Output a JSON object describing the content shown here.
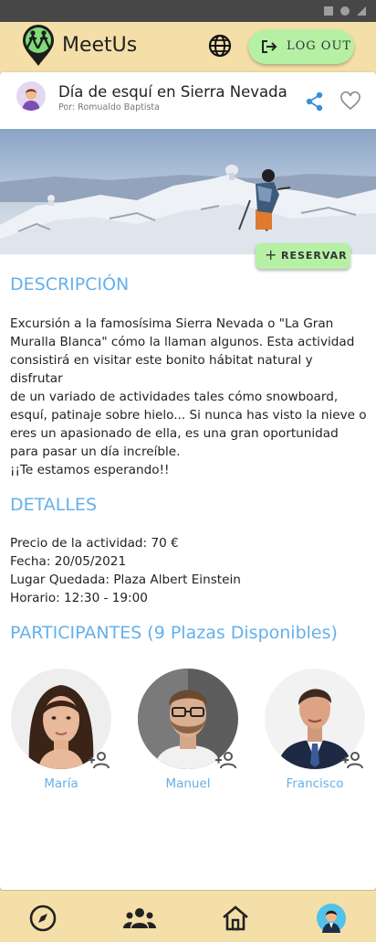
{
  "app": {
    "name": "MeetUs",
    "logout_label": "LOG OUT"
  },
  "event": {
    "title": "Día de esquí en Sierra Nevada",
    "author": "Por: Romualdo Baptista",
    "reserve_label": "RESERVAR"
  },
  "description": {
    "heading": "DESCRIPCIÓN",
    "lines": [
      "Excursión a la famosísima Sierra Nevada o \"La Gran",
      "Muralla Blanca\" cómo la llaman algunos. Esta actividad",
      "consistirá en visitar este bonito hábitat natural y disfrutar",
      "de un variado de actividades tales cómo snowboard,",
      "esquí, patinaje sobre hielo... Si nunca has visto la nieve o",
      "eres un apasionado de ella, es una gran oportunidad",
      "para pasar un día increíble."
    ],
    "closing": "¡¡Te estamos esperando!!"
  },
  "details": {
    "heading": "DETALLES",
    "price": "Precio de la actividad: 70 €",
    "date": "Fecha: 20/05/2021",
    "place": "Lugar Quedada: Plaza Albert Einstein",
    "schedule": "Horario: 12:30 - 19:00"
  },
  "participants": {
    "heading": "PARTICIPANTES (9 Plazas Disponibles)",
    "people": [
      {
        "name": "María",
        "icon": "woman-portrait"
      },
      {
        "name": "Manuel",
        "icon": "man-glasses-portrait"
      },
      {
        "name": "Francisco",
        "icon": "man-suit-portrait"
      }
    ]
  },
  "nav": [
    "compass-icon",
    "group-icon",
    "home-icon",
    "profile-avatar"
  ],
  "colors": {
    "accent_blue": "#64b0ea",
    "button_green": "#b6f0a5",
    "bar_beige": "#f5dfa8"
  }
}
